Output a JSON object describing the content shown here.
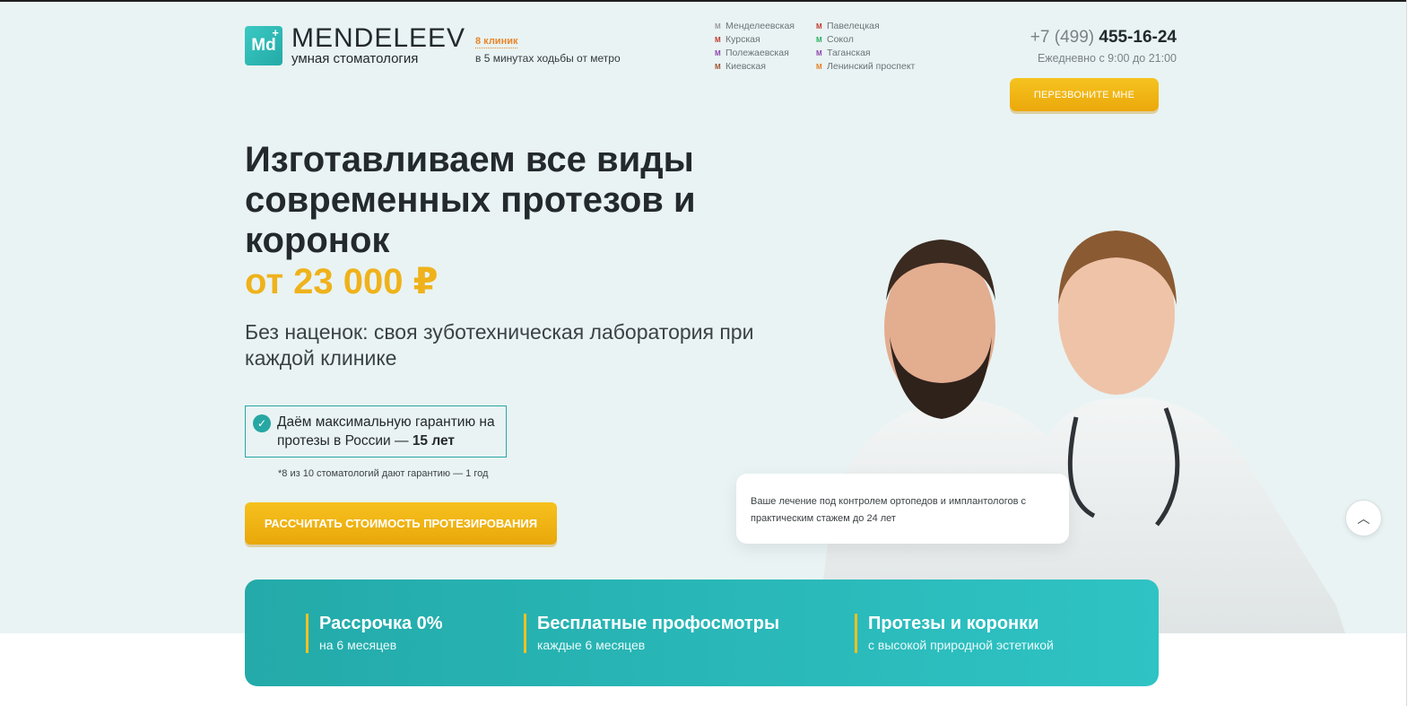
{
  "header": {
    "logo_mark": "Md",
    "logo_name": "MENDELEEV",
    "logo_sub": "умная стоматология",
    "clinics_link": "8 клиник",
    "clinics_note": "в 5 минутах ходьбы от метро",
    "metro": [
      [
        {
          "name": "Менделеевская",
          "color": "#9a9a9a"
        },
        {
          "name": "Курская",
          "color": "#c0392b"
        },
        {
          "name": "Полежаевская",
          "color": "#8e44ad"
        },
        {
          "name": "Киевская",
          "color": "#a0522d"
        }
      ],
      [
        {
          "name": "Павелецкая",
          "color": "#c0392b"
        },
        {
          "name": "Сокол",
          "color": "#27ae60"
        },
        {
          "name": "Таганская",
          "color": "#8e44ad"
        },
        {
          "name": "Ленинский проспект",
          "color": "#e67e22"
        }
      ]
    ],
    "phone_code": "+7 (499)",
    "phone_number": "455-16-24",
    "hours": "Ежедневно с 9:00 до 21:00",
    "callback_label": "ПЕРЕЗВОНИТЕ МНЕ"
  },
  "hero": {
    "title_line1": "Изготавливаем все виды",
    "title_line2": "современных протезов и",
    "title_line3": "коронок",
    "price": "от 23 000 ₽",
    "subtitle": "Без наценок: своя зуботехническая лаборатория при каждой клинике",
    "guarantee_text": "Даём максимальную гарантию на протезы в России —",
    "guarantee_years": "15 лет",
    "guarantee_note": "*8 из 10 стоматологий дают гарантию — 1 год",
    "cta_label": "РАССЧИТАТЬ СТОИМОСТЬ ПРОТЕЗИРОВАНИЯ",
    "quote": "Ваше лечение под контролем ортопедов и имплантологов с практическим стажем до 24 лет"
  },
  "benefits": [
    {
      "title": "Рассрочка 0%",
      "sub": "на 6 месяцев"
    },
    {
      "title": "Бесплатные профосмотры",
      "sub": "каждые 6 месяцев"
    },
    {
      "title": "Протезы и коронки",
      "sub": "с высокой природной эстетикой"
    }
  ],
  "colors": {
    "accent_teal": "#27a7a3",
    "accent_yellow": "#efb21b",
    "clinics_orange": "#e8862a",
    "hero_bg": "#e9f3f3"
  },
  "icons": {
    "logo": "md-logo-icon",
    "metro": "metro-icon",
    "guarantee": "check-badge-icon",
    "scroll_top": "chevron-up-icon"
  }
}
